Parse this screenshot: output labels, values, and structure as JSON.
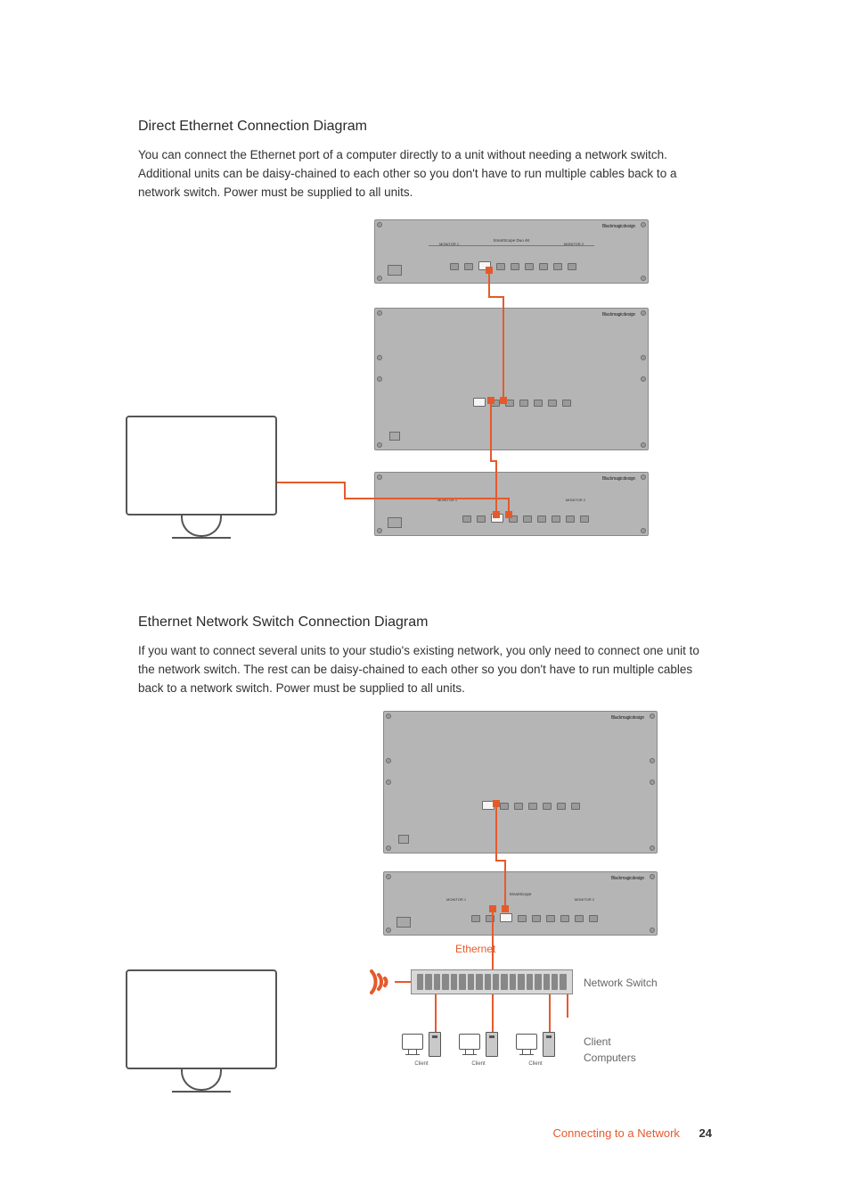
{
  "section1": {
    "heading": "Direct Ethernet Connection Diagram",
    "paragraph": "You can connect the Ethernet port of a computer directly to a unit without needing a network switch. Additional units can be daisy-chained to each other so you don't have to run multiple cables back to a network switch. Power must be supplied to all units."
  },
  "section2": {
    "heading": "Ethernet Network Switch Connection Diagram",
    "paragraph": "If you want to connect several units to your studio's existing network, you only need to connect one unit to the network switch. The rest can be daisy-chained to each other so you don't have to run multiple cables back to a network switch. Power must be supplied to all units."
  },
  "diagram1": {
    "device_brand": "Blackmagicdesign",
    "device1_model": "SmartScope Duo 4K",
    "monitor_label_a": "MONITOR 1",
    "monitor_label_b": "MONITOR 2"
  },
  "diagram2": {
    "device_brand": "Blackmagicdesign",
    "ethernet_label": "Ethernet",
    "switch_label": "Network Switch",
    "clients_label": "Client\nComputers",
    "client_unit_label": "Client"
  },
  "footer": {
    "section": "Connecting to a Network",
    "page": "24"
  }
}
